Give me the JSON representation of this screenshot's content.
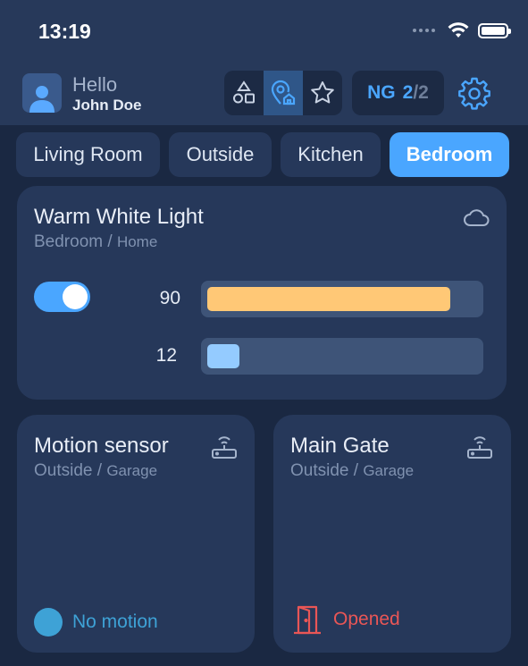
{
  "status_bar": {
    "time": "13:19"
  },
  "header": {
    "greeting": "Hello",
    "user_name": "John Doe",
    "view_modes": [
      {
        "icon": "shapes-icon",
        "active": false
      },
      {
        "icon": "location-home-icon",
        "active": true
      },
      {
        "icon": "star-icon",
        "active": false
      }
    ],
    "network": {
      "label": "NG",
      "current": "2",
      "total": "/2"
    }
  },
  "tabs": [
    {
      "label": "Living Room",
      "active": false
    },
    {
      "label": "Outside",
      "active": false
    },
    {
      "label": "Kitchen",
      "active": false
    },
    {
      "label": "Bedroom",
      "active": true
    }
  ],
  "light_card": {
    "title": "Warm White Light",
    "location": "Bedroom",
    "separator": "/",
    "group": "Home",
    "icon": "cloud-icon",
    "on": true,
    "brightness": {
      "value": "90",
      "fill_fraction": 0.9,
      "color": "#ffc876"
    },
    "temperature": {
      "value": "12",
      "fill_fraction": 0.12,
      "color": "#94cbff"
    }
  },
  "sensor_cards": [
    {
      "title": "Motion sensor",
      "location": "Outside",
      "separator": "/",
      "group": "Garage",
      "icon": "router-icon",
      "status": "No motion",
      "status_color": "#3ea2d6"
    },
    {
      "title": "Main Gate",
      "location": "Outside",
      "separator": "/",
      "group": "Garage",
      "icon": "router-icon",
      "status": "Opened",
      "status_icon": "door-open-icon",
      "status_color": "#e95656"
    }
  ],
  "colors": {
    "accent": "#4aa6ff",
    "card": "#26385a",
    "background": "#1a2842"
  }
}
